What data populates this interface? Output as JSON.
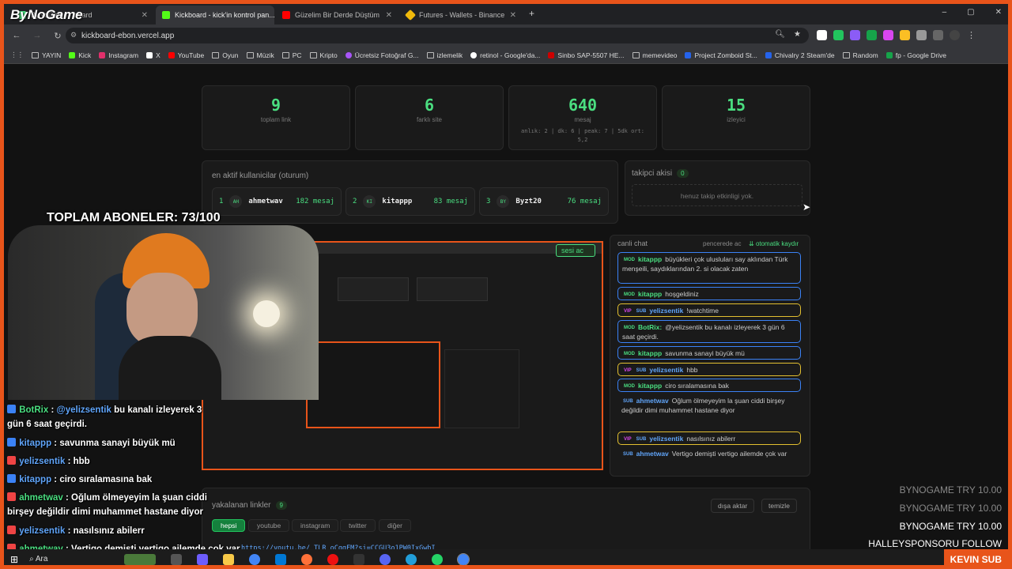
{
  "browser": {
    "tabs": [
      {
        "title": "ByNoGame · board",
        "active": false,
        "icon": "logo-icon"
      },
      {
        "title": "Kickboard - kick'in kontrol pan...",
        "active": true,
        "icon": "k-icon"
      },
      {
        "title": "Güzelim Bir Derde Düştüm",
        "active": false,
        "icon": "youtube-icon"
      },
      {
        "title": "Futures - Wallets - Binance",
        "active": false,
        "icon": "binance-icon"
      }
    ],
    "new_tab": "+",
    "window_controls": [
      "–",
      "▢",
      "✕"
    ],
    "url": "kickboard-ebon.vercel.app",
    "bookmarks": [
      "YAYIN",
      "Kick",
      "Instagram",
      "X",
      "YouTube",
      "Oyun",
      "Müzik",
      "PC",
      "Kripto",
      "Ücretsiz Fotoğraf G...",
      "izlemelik",
      "retinol - Google'da...",
      "Sinbo SAP-5507 HE...",
      "memevideo",
      "Project Zomboid St...",
      "Chivalry 2 Steam'de",
      "Random",
      "fp - Google Drive"
    ]
  },
  "stats": [
    {
      "value": "9",
      "label": "toplam link"
    },
    {
      "value": "6",
      "label": "farklı site"
    },
    {
      "value": "640",
      "label": "mesaj",
      "sub": "anlık: 2 | dk: 6 | peak: 7 | 5dk ort: 5,2"
    },
    {
      "value": "15",
      "label": "izleyici"
    }
  ],
  "active_users": {
    "title": "en aktif kullanicilar (oturum)",
    "users": [
      {
        "rank": "1",
        "avatar": "AH",
        "name": "ahmetwav",
        "count": "182 mesaj"
      },
      {
        "rank": "2",
        "avatar": "KI",
        "name": "kitappp",
        "count": "83 mesaj"
      },
      {
        "rank": "3",
        "avatar": "BY",
        "name": "Byzt20",
        "count": "76 mesaj"
      }
    ]
  },
  "follow_flow": {
    "title": "takipci akisi",
    "count": "0",
    "empty": "henuz takip etkinligi yok."
  },
  "live_chat": {
    "title": "canli chat",
    "popout": "pencerede ac",
    "autoscroll": "otomatik kaydır",
    "sound_btn": "sesi ac",
    "messages": [
      {
        "tags": [
          "MOD"
        ],
        "user": "kitappp",
        "text": "büyükleri çok ulusluları say aklından Türk menşeili, saydıklarından 2. si olacak zaten",
        "border": "blue"
      },
      {
        "tags": [
          "MOD"
        ],
        "user": "kitappp",
        "text": "hoşgeldiniz",
        "border": "blue"
      },
      {
        "tags": [
          "VIP",
          "SUB"
        ],
        "user": "yelizsentik",
        "text": "!watchtime",
        "border": "gold"
      },
      {
        "tags": [
          "MOD"
        ],
        "user": "BotRix:",
        "text": "@yelizsentik bu kanalı izleyerek 3 gün 6 saat geçirdi.",
        "border": "blue"
      },
      {
        "tags": [
          "MOD"
        ],
        "user": "kitappp",
        "text": "savunma sanayi büyük mü",
        "border": "blue"
      },
      {
        "tags": [
          "VIP",
          "SUB"
        ],
        "user": "yelizsentik",
        "text": "hbb",
        "border": "gold"
      },
      {
        "tags": [
          "MOD"
        ],
        "user": "kitappp",
        "text": "ciro sıralamasına bak",
        "border": "blue"
      },
      {
        "tags": [
          "SUB"
        ],
        "user": "ahmetwav",
        "text": "Oğlum ölmeyeyim la şuan ciddi birşey değildir dimi muhammet hastane diyor",
        "border": "none"
      },
      {
        "tags": [
          "VIP",
          "SUB"
        ],
        "user": "yelizsentik",
        "text": "nasılsınız abilerr",
        "border": "gold"
      },
      {
        "tags": [
          "SUB"
        ],
        "user": "ahmetwav",
        "text": "Vertigo demişti vertigo ailemde çok var",
        "border": "none"
      }
    ]
  },
  "links": {
    "title": "yakalanan linkler",
    "count": "9",
    "export": "dışa aktar",
    "clear": "temizle",
    "filters": [
      "hepsi",
      "youtube",
      "instagram",
      "twitter",
      "diğer"
    ],
    "first_link": "https://youtu.be/_TLR_oCqqFM?si=CCGU3o1PW0IxGwbI"
  },
  "overlay": {
    "brand": "ByNoGame",
    "subgoal": "TOPLAM ABONELER: 73/100",
    "chat": [
      {
        "user": "BotRix",
        "mention": "@yelizsentik",
        "text": " bu kanalı izleyerek 3 gün 6 saat geçirdi."
      },
      {
        "user": "kitappp",
        "text": "savunma sanayi büyük mü"
      },
      {
        "user": "yelizsentik",
        "text": "hbb"
      },
      {
        "user": "kitappp",
        "text": "ciro sıralamasına bak"
      },
      {
        "user": "ahmetwav",
        "text": "Oğlum ölmeyeyim la şuan ciddi birşey değildir dimi muhammet hastane diyor"
      },
      {
        "user": "yelizsentik",
        "text": "nasılsınız abilerr"
      },
      {
        "user": "ahmetwav",
        "text": "Vertigo demişti vertigo ailemde çok var"
      }
    ],
    "ticker": [
      "BYNOGAME  TRY 10.00",
      "BYNOGAME  TRY 10.00",
      "BYNOGAME  TRY 10.00",
      "HALLEYSPONSORU  FOLLOW"
    ],
    "kevin": "KEVIN  SUB"
  },
  "taskbar": {
    "search": "Ara"
  }
}
